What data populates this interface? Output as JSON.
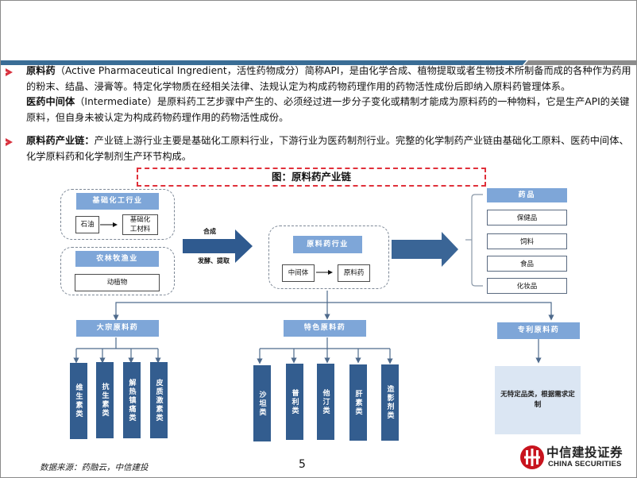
{
  "header": {
    "band_colors": {
      "primary": "#3a6d96",
      "secondary": "#8c8c8c"
    }
  },
  "paragraphs": [
    {
      "term": "原料药",
      "text": "（Active Pharmaceutical Ingredient，活性药物成分）简称API，是由化学合成、植物提取或者生物技术所制备而成的各种作为药用的粉末、结晶、浸膏等。特定化学物质在经相关法律、法规认定为构成药物药理作用的药物活性成份后即纳入原料药管理体系。",
      "term2": "医药中间体",
      "text2": "（Intermediate）是原料药工艺步骤中产生的、必须经过进一步分子变化或精制才能成为原料药的一种物料，它是生产API的关键原料，但自身未被认定为构成药物药理作用的药物活性成份。"
    },
    {
      "term": "原料药产业链：",
      "text": "产业链上游行业主要是基础化工原料行业，下游行业为医药制剂行业。完整的化学制药产业链由基础化工原料、医药中间体、化学原料药和化学制剂生产环节构成。"
    }
  ],
  "figure": {
    "title": "图：原料药产业链",
    "upstream": {
      "chem_industry": {
        "label": "基础化工行业",
        "from": "石油",
        "to": "基础化工材料"
      },
      "agri_industry": {
        "label": "农林牧渔业",
        "item": "动植物"
      }
    },
    "arrow_labels": {
      "top": "合成",
      "bottom": "发酵、提取"
    },
    "midstream": {
      "label": "原料药行业",
      "from": "中间体",
      "to": "原料药"
    },
    "downstream": [
      "药品",
      "保健品",
      "饲料",
      "食品",
      "化妆品"
    ],
    "categories": [
      {
        "label": "大宗原料药",
        "items": [
          "维生素类",
          "抗生素类",
          "解热镇痛类",
          "皮质激素类"
        ]
      },
      {
        "label": "特色原料药",
        "items": [
          "沙坦类",
          "普利类",
          "他汀类",
          "肝素类",
          "造影剂类"
        ]
      },
      {
        "label": "专利原料药",
        "note": "无特定品类，根据需求定制"
      }
    ]
  },
  "footer": {
    "source": "数据来源：药融云，中信建投",
    "page": "5",
    "logo_cn": "中信建投证券",
    "logo_en": "CHINA SECURITIES"
  }
}
